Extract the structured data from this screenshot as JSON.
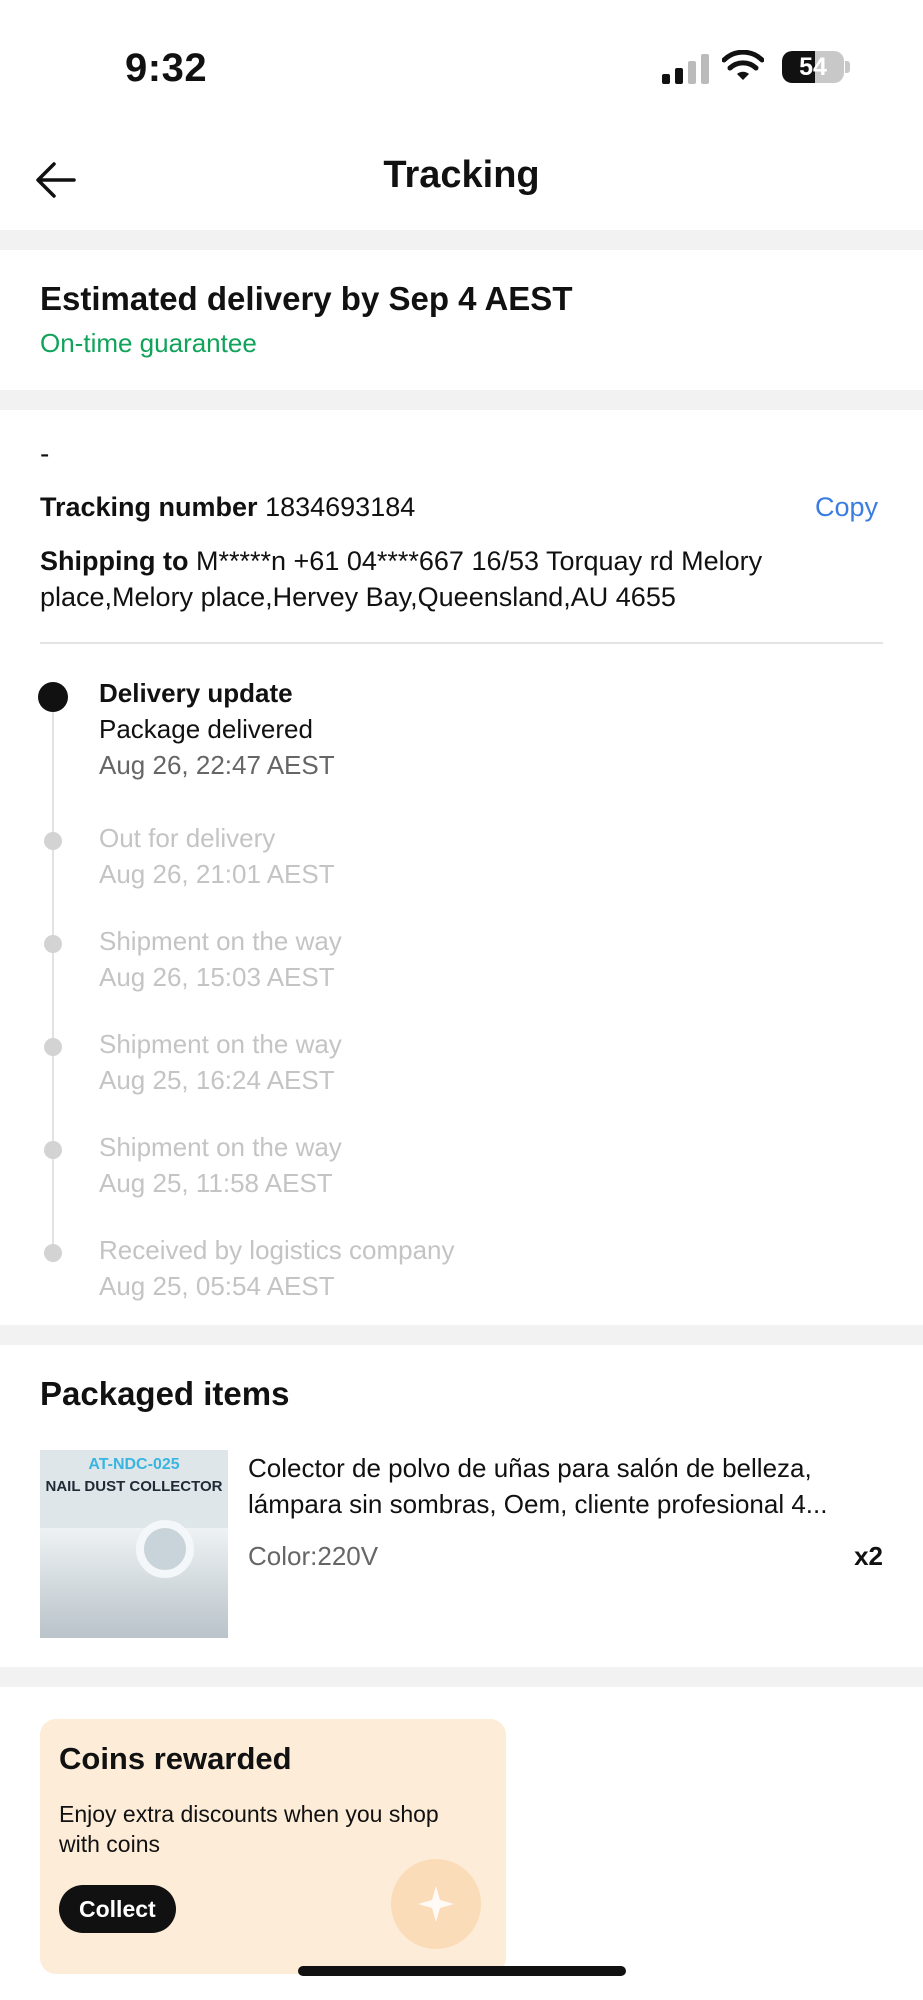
{
  "status_bar": {
    "time": "9:32",
    "battery": "54",
    "battery_level": 0.54
  },
  "nav": {
    "title": "Tracking"
  },
  "estimate": {
    "title": "Estimated delivery by Sep 4 AEST",
    "guarantee": "On-time guarantee"
  },
  "tracking": {
    "carrier": "-",
    "number_label": "Tracking number",
    "number": "1834693184",
    "copy_label": "Copy",
    "shipping_label": "Shipping to",
    "shipping_address": "M*****n +61 04****667 16/53  Torquay rd Melory place,Melory place,Hervey Bay,Queensland,AU 4655",
    "events": [
      {
        "heading": "Delivery update",
        "status": "Package delivered",
        "time": "Aug 26, 22:47 AEST"
      },
      {
        "status": "Out for delivery",
        "time": "Aug 26, 21:01 AEST"
      },
      {
        "status": "Shipment on the way",
        "time": "Aug 26, 15:03 AEST"
      },
      {
        "status": "Shipment on the way",
        "time": "Aug 25, 16:24 AEST"
      },
      {
        "status": "Shipment on the way",
        "time": "Aug 25, 11:58 AEST"
      },
      {
        "status": "Received by logistics company",
        "time": "Aug 25, 05:54 AEST"
      }
    ]
  },
  "packaged": {
    "title": "Packaged items",
    "item": {
      "image_code": "AT-NDC-025",
      "image_title": "NAIL DUST COLLECTOR",
      "name": "Colector de polvo de uñas para salón de belleza, lámpara sin sombras, Oem, cliente profesional 4...",
      "variant": "Color:220V",
      "quantity": "x2"
    }
  },
  "coins": {
    "title": "Coins rewarded",
    "description": "Enjoy extra discounts when you shop with coins",
    "collect_label": "Collect"
  }
}
